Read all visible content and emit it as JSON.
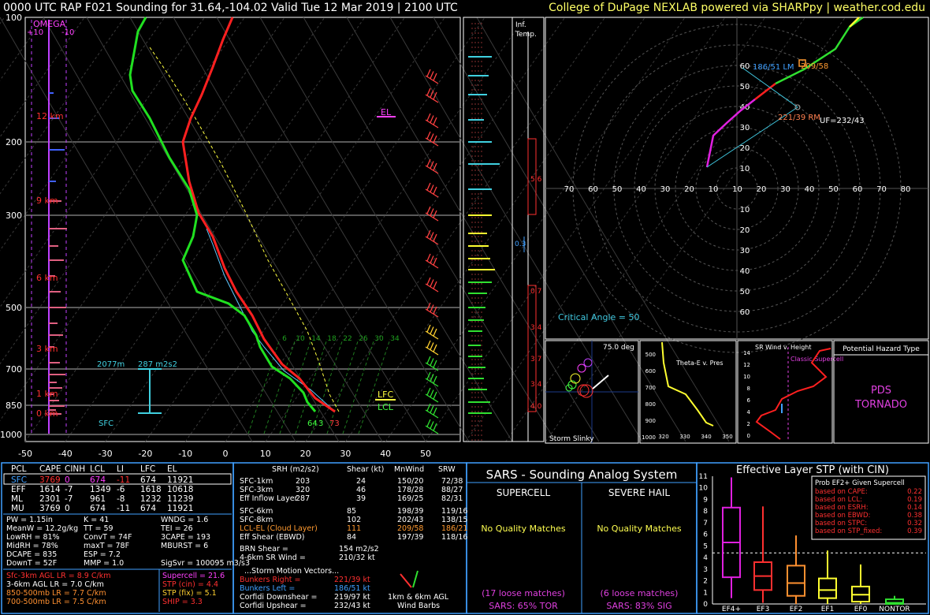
{
  "header": {
    "title": "0000 UTC RAP F021 Sounding for 31.64,-104.02 Valid  Tue 12 Mar 2019 | 2100 UTC",
    "credit": "College of DuPage NEXLAB powered via SHARPpy | weather.cod.edu"
  },
  "skewt": {
    "omega_label": "OMEGA",
    "omega_ticks": [
      "+10",
      "-10"
    ],
    "pressure_ticks": [
      "100",
      "200",
      "300",
      "500",
      "700",
      "850",
      "1000"
    ],
    "temp_ticks": [
      "-50",
      "-40",
      "-30",
      "-20",
      "-10",
      "0",
      "10",
      "20",
      "30",
      "40",
      "50"
    ],
    "height_labels": [
      "12 km",
      "9 km",
      "6 km",
      "3 km",
      "1 km",
      "0 km"
    ],
    "el_label": "EL",
    "lfc_label": "LFC",
    "lcl_label": "LCL",
    "effective_layer_height": "2077m",
    "effective_layer_srh": "287 m2s2",
    "sfc_label": "SFC",
    "sfc_dewpoint": "64",
    "sfc_temp": "73",
    "sfc_wind": "3",
    "mixing_ratio_labels": [
      "6",
      "10",
      "14",
      "18",
      "22",
      "26",
      "30",
      "34"
    ]
  },
  "inf_temp": {
    "title_line1": "Inf.",
    "title_line2": "Temp.",
    "labels": [
      "5.6",
      "0.3",
      "0.7",
      "3.4",
      "3.7",
      "3.4",
      "4.0"
    ]
  },
  "hodograph": {
    "rings": [
      "10",
      "20",
      "30",
      "40",
      "50",
      "60"
    ],
    "x_ticks": [
      "70",
      "60",
      "50",
      "40",
      "30",
      "20",
      "10",
      "10",
      "20",
      "30",
      "40",
      "50",
      "60",
      "70",
      "80"
    ],
    "lm_label": "186/51 LM",
    "rm_label": "221/39 RM",
    "uf_label": "UF=232/43",
    "mean_label": "209/58",
    "critical_angle": "Critical Angle = 50"
  },
  "slinky": {
    "angle": "75.0 deg",
    "title": "Storm Slinky"
  },
  "thetae": {
    "title": "Theta-E v. Pres",
    "x_ticks": [
      "320",
      "330",
      "340",
      "350"
    ],
    "y_ticks": [
      "500",
      "600",
      "700",
      "800",
      "900",
      "1000"
    ]
  },
  "srwind": {
    "title": "SR Wind v. Height",
    "classic": "Classic Supercell",
    "y_ticks": [
      "14",
      "12",
      "10",
      "8",
      "6",
      "4",
      "2",
      "0"
    ]
  },
  "hazard": {
    "title": "Potential Hazard Type",
    "value_line1": "PDS",
    "value_line2": "TORNADO"
  },
  "parcels": {
    "headers": [
      "PCL",
      "CAPE",
      "CINH",
      "LCL",
      "LI",
      "LFC",
      "EL"
    ],
    "rows": [
      [
        "SFC",
        "3769",
        "0",
        "674",
        "-11",
        "674",
        "11921"
      ],
      [
        "EFF",
        "1614",
        "-7",
        "1349",
        "-6",
        "1618",
        "10618"
      ],
      [
        "ML",
        "2301",
        "-7",
        "961",
        "-8",
        "1232",
        "11239"
      ],
      [
        "MU",
        "3769",
        "0",
        "674",
        "-11",
        "674",
        "11921"
      ]
    ]
  },
  "indices": {
    "col1": [
      "PW = 1.15in",
      "MeanW = 12.2g/kg",
      "LowRH = 81%",
      "MidRH = 78%",
      "DCAPE = 835",
      "DownT = 52F"
    ],
    "col2": [
      "K = 41",
      "TT = 59",
      "ConvT = 74F",
      "maxT = 78F",
      "ESP = 7.2",
      "MMP = 1.0"
    ],
    "col3": [
      "WNDG = 1.6",
      "TEI = 26",
      "3CAPE = 193",
      "MBURST = 6",
      "",
      "SigSvr = 100095 m3/s3"
    ],
    "lapse": [
      "Sfc-3km AGL LR = 8.9 C/km",
      "3-6km AGL LR = 7.0 C/km",
      "850-500mb LR = 7.7 C/km",
      "700-500mb LR = 7.5 C/km"
    ],
    "composite": [
      "Supercell = 21.6",
      "STP (cin) = 4.4",
      "STP (fix) = 5.1",
      "SHIP = 3.3"
    ]
  },
  "kinematics": {
    "headers": [
      "SRH (m2/s2)",
      "Shear (kt)",
      "MnWind",
      "SRW"
    ],
    "rows": [
      [
        "SFC-1km",
        "203",
        "24",
        "150/20",
        "72/38"
      ],
      [
        "SFC-3km",
        "320",
        "46",
        "178/28",
        "88/27"
      ],
      [
        "Eff Inflow Layer",
        "287",
        "39",
        "169/25",
        "82/31"
      ],
      [
        "SFC-6km",
        "85",
        "198/39",
        "119/16",
        ""
      ],
      [
        "SFC-8km",
        "102",
        "202/43",
        "138/15",
        ""
      ],
      [
        "LCL-EL (Cloud Layer)",
        "111",
        "209/58",
        "186/21",
        ""
      ],
      [
        "Eff Shear (EBWD)",
        "84",
        "197/39",
        "118/16",
        ""
      ]
    ],
    "brn": "BRN Shear =",
    "brn_val": "154 m2/s2",
    "srw46": "4-6km SR Wind =",
    "srw46_val": "210/32 kt",
    "storm_motion": "...Storm Motion Vectors...",
    "motions": [
      [
        "Bunkers Right =",
        "221/39 kt"
      ],
      [
        "Bunkers Left =",
        "186/51 kt"
      ],
      [
        "Corfidi Downshear =",
        "219/97 kt"
      ],
      [
        "Corfidi Upshear =",
        "232/43 kt"
      ]
    ],
    "barbs_label1": "1km & 6km AGL",
    "barbs_label2": "Wind Barbs"
  },
  "sars": {
    "title": "SARS - Sounding Analog System",
    "supercell": "SUPERCELL",
    "hail": "SEVERE HAIL",
    "sup_match": "No Quality Matches",
    "hail_match": "No Quality Matches",
    "sup_loose": "(17 loose matches)",
    "hail_loose": "(6 loose matches)",
    "sup_pct": "SARS: 65% TOR",
    "hail_pct": "SARS: 83% SIG"
  },
  "stp": {
    "title": "Effective Layer STP (with CIN)",
    "y_ticks": [
      "11",
      "10",
      "9",
      "8",
      "7",
      "6",
      "5",
      "4",
      "3",
      "2",
      "1",
      "0"
    ],
    "categories": [
      "EF4+",
      "EF3",
      "EF2",
      "EF1",
      "EF0",
      "NONTOR"
    ],
    "prob_title": "Prob EF2+ Given Supercell",
    "prob_rows": [
      [
        "based on CAPE:",
        "0.22"
      ],
      [
        "based on LCL:",
        "0.19"
      ],
      [
        "based on ESRH:",
        "0.14"
      ],
      [
        "based on EBWD:",
        "0.38"
      ],
      [
        "based on STPC:",
        "0.32"
      ],
      [
        "based on STP_fixed:",
        "0.39"
      ]
    ]
  },
  "chart_data": [
    {
      "type": "line",
      "title": "Skew-T",
      "xlabel": "",
      "ylabel": "",
      "temp_profile": [
        [
          1000,
          26
        ],
        [
          850,
          21
        ],
        [
          700,
          10
        ],
        [
          500,
          -8
        ],
        [
          400,
          -17
        ],
        [
          300,
          -31
        ],
        [
          200,
          -54
        ],
        [
          100,
          -70
        ]
      ],
      "dewpoint_profile": [
        [
          900,
          20
        ],
        [
          850,
          17
        ],
        [
          700,
          7
        ],
        [
          600,
          -10
        ],
        [
          500,
          -30
        ],
        [
          400,
          -27
        ],
        [
          300,
          -40
        ],
        [
          200,
          -62
        ],
        [
          100,
          -80
        ]
      ]
    },
    {
      "type": "scatter",
      "title": "Hodograph",
      "rings_kt": [
        10,
        20,
        30,
        40,
        50,
        60
      ]
    },
    {
      "type": "bar",
      "title": "Effective Layer STP (with CIN)",
      "categories": [
        "EF4+",
        "EF3",
        "EF2",
        "EF1",
        "EF0",
        "NONTOR"
      ],
      "median": [
        5.3,
        2.4,
        1.8,
        1.2,
        0.8,
        0.1
      ],
      "q1": [
        2.3,
        1.2,
        0.7,
        0.5,
        0.2,
        0.0
      ],
      "q3": [
        8.3,
        3.6,
        3.3,
        2.2,
        1.5,
        0.4
      ],
      "wmin": [
        0.5,
        0.1,
        0.0,
        0.0,
        0.0,
        0.0
      ],
      "wmax": [
        10.9,
        8.4,
        5.9,
        4.6,
        3.4,
        0.7
      ],
      "ylim": [
        0,
        11
      ]
    }
  ]
}
